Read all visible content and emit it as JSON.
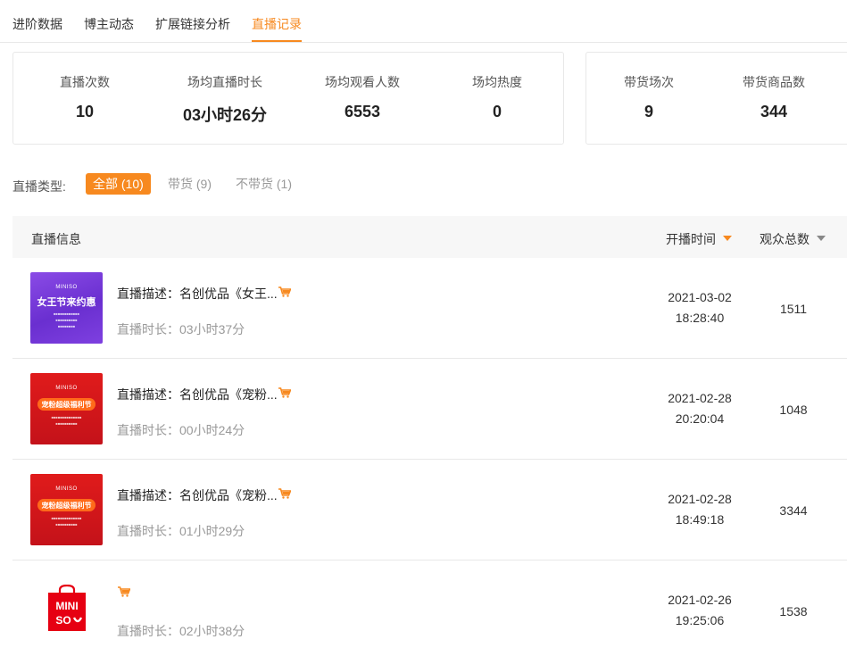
{
  "tabs": [
    {
      "label": "进阶数据",
      "active": false
    },
    {
      "label": "博主动态",
      "active": false
    },
    {
      "label": "扩展链接分析",
      "active": false
    },
    {
      "label": "直播记录",
      "active": true
    }
  ],
  "summary": {
    "live_count": {
      "label": "直播次数",
      "value": "10"
    },
    "avg_duration": {
      "label": "场均直播时长",
      "value": "03小时26分"
    },
    "avg_viewers": {
      "label": "场均观看人数",
      "value": "6553"
    },
    "avg_heat": {
      "label": "场均热度",
      "value": "0"
    },
    "sales_sessions": {
      "label": "带货场次",
      "value": "9"
    },
    "sales_products": {
      "label": "带货商品数",
      "value": "344"
    }
  },
  "filter": {
    "label": "直播类型:",
    "options": [
      "全部 (10)",
      "带货 (9)",
      "不带货 (1)"
    ],
    "selected": "全部 (10)"
  },
  "table": {
    "headers": {
      "info": "直播信息",
      "start_time": "开播时间",
      "viewers": "观众总数"
    },
    "sort_column": "开播时间",
    "rows": [
      {
        "thumbnail": {
          "brand": "MINISO",
          "headline": "女王节来约惠",
          "style": "purple"
        },
        "description": "直播描述：名创优品《女王...",
        "duration": "直播时长：03小时37分",
        "date": "2021-03-02",
        "time": "18:28:40",
        "viewers": "1511"
      },
      {
        "thumbnail": {
          "brand": "MINISO",
          "headline": "宠粉超级福利节",
          "style": "red"
        },
        "description": "直播描述：名创优品《宠粉...",
        "duration": "直播时长：00小时24分",
        "date": "2021-02-28",
        "time": "20:20:04",
        "viewers": "1048"
      },
      {
        "thumbnail": {
          "brand": "MINISO",
          "headline": "宠粉超级福利节",
          "style": "red"
        },
        "description": "直播描述：名创优品《宠粉...",
        "duration": "直播时长：01小时29分",
        "date": "2021-02-28",
        "time": "18:49:18",
        "viewers": "3344"
      },
      {
        "thumbnail": {
          "brand": "MINISO",
          "headline": "MINI SO",
          "style": "logo"
        },
        "description": "",
        "duration": "直播时长：02小时38分",
        "date": "2021-02-26",
        "time": "19:25:06",
        "viewers": "1538"
      }
    ]
  },
  "colors": {
    "accent": "#f7891f",
    "cart_icon": "#f7891f",
    "logo_red": "#e60012"
  },
  "icons": {
    "cart": "shopping-cart-icon",
    "sort_desc": "caret-down-icon"
  }
}
